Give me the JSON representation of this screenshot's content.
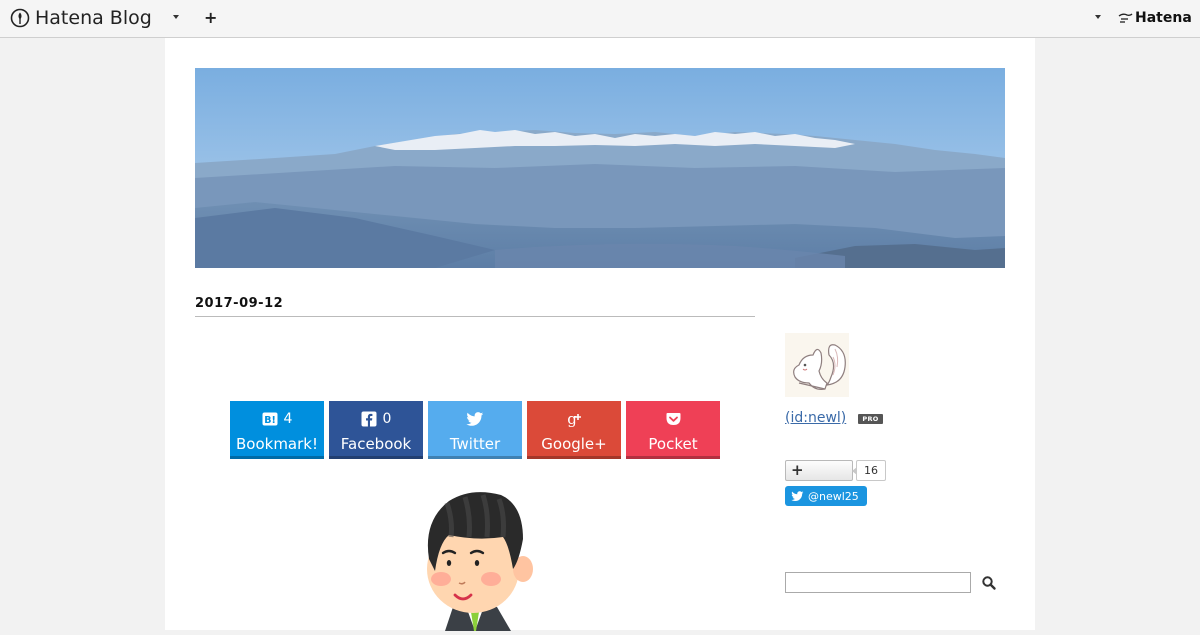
{
  "topbar": {
    "brand": "Hatena Blog",
    "company": "Hatena"
  },
  "article": {
    "date": "2017-09-12"
  },
  "share": [
    {
      "label": "Bookmark!",
      "count": "4",
      "icon": "hatena-bookmark-icon",
      "color": "#008fde"
    },
    {
      "label": "Facebook",
      "count": "0",
      "icon": "facebook-icon",
      "color": "#2e5497"
    },
    {
      "label": "Twitter",
      "count": "",
      "icon": "twitter-icon",
      "color": "#55acee"
    },
    {
      "label": "Google+",
      "count": "",
      "icon": "google-plus-icon",
      "color": "#db4a39"
    },
    {
      "label": "Pocket",
      "count": "",
      "icon": "pocket-icon",
      "color": "#ef4056"
    }
  ],
  "sidebar": {
    "profile_name": " (id:newl)",
    "pro_badge": "PRO",
    "follow_count": "16",
    "twitter_handle": "@newl25"
  }
}
